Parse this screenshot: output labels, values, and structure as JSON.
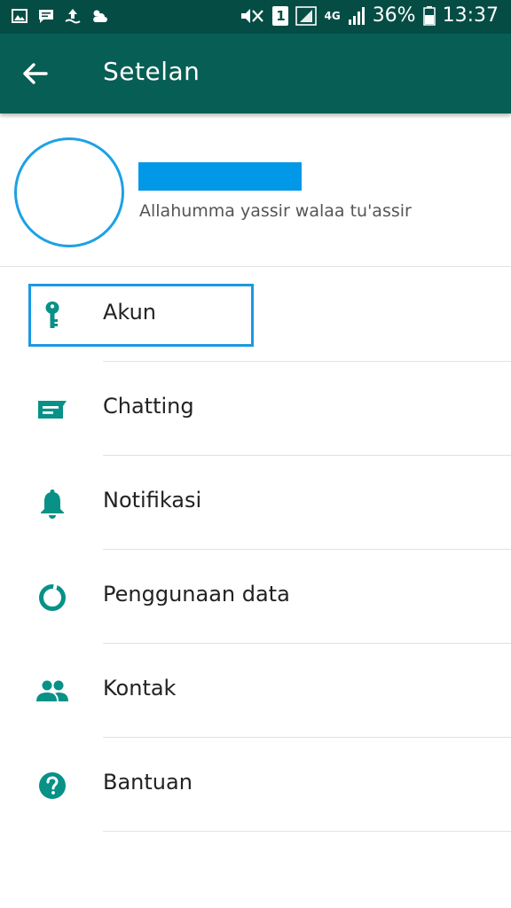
{
  "status_bar": {
    "battery": "36%",
    "time": "13:37",
    "network": "4G",
    "sim": "1"
  },
  "header": {
    "title": "Setelan"
  },
  "profile": {
    "status_text": "Allahumma yassir walaa tu'assir"
  },
  "menu": [
    {
      "label": "Akun",
      "icon": "key-icon"
    },
    {
      "label": "Chatting",
      "icon": "chat-icon"
    },
    {
      "label": "Notifikasi",
      "icon": "bell-icon"
    },
    {
      "label": "Penggunaan data",
      "icon": "data-usage-icon"
    },
    {
      "label": "Kontak",
      "icon": "contacts-icon"
    },
    {
      "label": "Bantuan",
      "icon": "help-icon"
    }
  ],
  "colors": {
    "status_bar": "#054d44",
    "app_bar": "#075e54",
    "icon_teal": "#079187",
    "highlight_blue": "#1a99e3"
  }
}
